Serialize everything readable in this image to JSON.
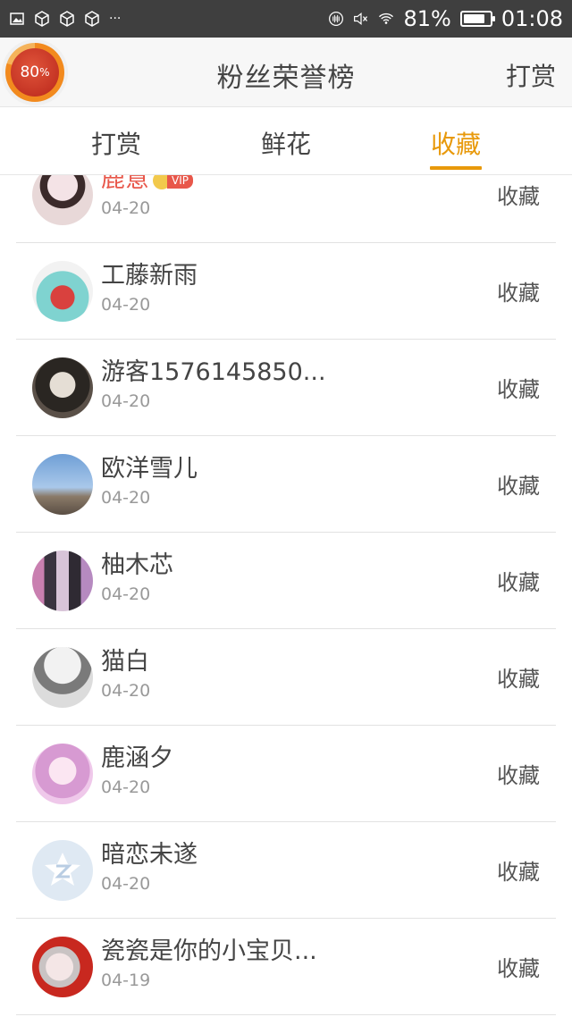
{
  "status_bar": {
    "left_icons": [
      "image-icon",
      "package-icon",
      "package-icon",
      "package-icon"
    ],
    "more": "···",
    "battery_percent": "81%",
    "battery_level": 0.81,
    "time": "01:08"
  },
  "header": {
    "progress_value": "80",
    "progress_unit": "%",
    "progress_fraction": 0.8,
    "title": "粉丝荣誉榜",
    "action": "打赏"
  },
  "tabs": [
    {
      "label": "打赏",
      "active": false
    },
    {
      "label": "鲜花",
      "active": false
    },
    {
      "label": "收藏",
      "active": true
    }
  ],
  "vip_label": "VIP",
  "colors": {
    "accent": "#e8990a",
    "vip": "#e8574a",
    "username_highlight": "#e8574a"
  },
  "list": [
    {
      "name": "鹿意",
      "date": "04-20",
      "action": "收藏",
      "vip": true
    },
    {
      "name": "工藤新雨",
      "date": "04-20",
      "action": "收藏",
      "vip": false
    },
    {
      "name": "游客1576145850...",
      "date": "04-20",
      "action": "收藏",
      "vip": false
    },
    {
      "name": "欧洋雪儿",
      "date": "04-20",
      "action": "收藏",
      "vip": false
    },
    {
      "name": "柚木芯",
      "date": "04-20",
      "action": "收藏",
      "vip": false
    },
    {
      "name": "猫白",
      "date": "04-20",
      "action": "收藏",
      "vip": false
    },
    {
      "name": "鹿涵夕",
      "date": "04-20",
      "action": "收藏",
      "vip": false
    },
    {
      "name": "暗恋未遂",
      "date": "04-20",
      "action": "收藏",
      "vip": false
    },
    {
      "name": "瓷瓷是你的小宝贝...",
      "date": "04-19",
      "action": "收藏",
      "vip": false
    }
  ]
}
